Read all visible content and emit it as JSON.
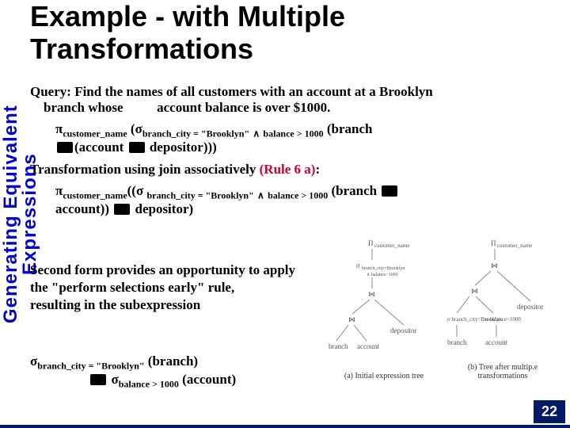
{
  "sidebar": {
    "label": "Generating Equivalent\nExpressions"
  },
  "title": "Example - with Multiple Transformations",
  "query": {
    "prefix": "Query:",
    "text1": "Find the names of all customers with an account at a Brooklyn",
    "text2": "branch whose",
    "text3": "account balance is over $1000."
  },
  "expr1": {
    "pi": "π",
    "pi_sub": "customer_name",
    "sigma": "σ",
    "sigma_sub": "branch_city = \"Brooklyn\"",
    "and": "∧",
    "cond2": "balance > 1000",
    "rel1": "(branch",
    "line2a": "(account",
    "line2b": "depositor)))"
  },
  "transform_line": {
    "t1": "Transformation using join associatively",
    "rule": "(Rule 6 a)",
    "colon": ":"
  },
  "expr2": {
    "pi": "π",
    "pi_sub": "customer_name",
    "sigma": "σ",
    "sigma_sub": "branch_city = \"Brooklyn\"",
    "and": "∧",
    "cond2": "balance > 1000",
    "rel1": "(branch",
    "line2a": "account))",
    "line2b": "depositor)"
  },
  "lower": {
    "l1": "Second form provides an opportunity to apply",
    "l2": "the \"perform selections early\" rule,",
    "l3": "resulting in the subexpression"
  },
  "subexpr": {
    "sigma": "σ",
    "s1_sub": "branch_city = \"Brooklyn\"",
    "s1_rel": "(branch)",
    "s2_sub": "balance > 1000",
    "s2_rel": "(account)"
  },
  "figure": {
    "top_label": "Π customer_name",
    "sigma_label": "σ branch_city=Brooklyn ∧ balance<1000",
    "join": "⋈",
    "branch": "branch",
    "account": "account",
    "depositor": "depositor",
    "sig_a": "σ branch_city=Brooklyn",
    "sig_b": "σ balance<1000",
    "cap_a": "(a) Initial expression tree",
    "cap_b": "(b) Tree after multip.e transformations"
  },
  "page": "22"
}
